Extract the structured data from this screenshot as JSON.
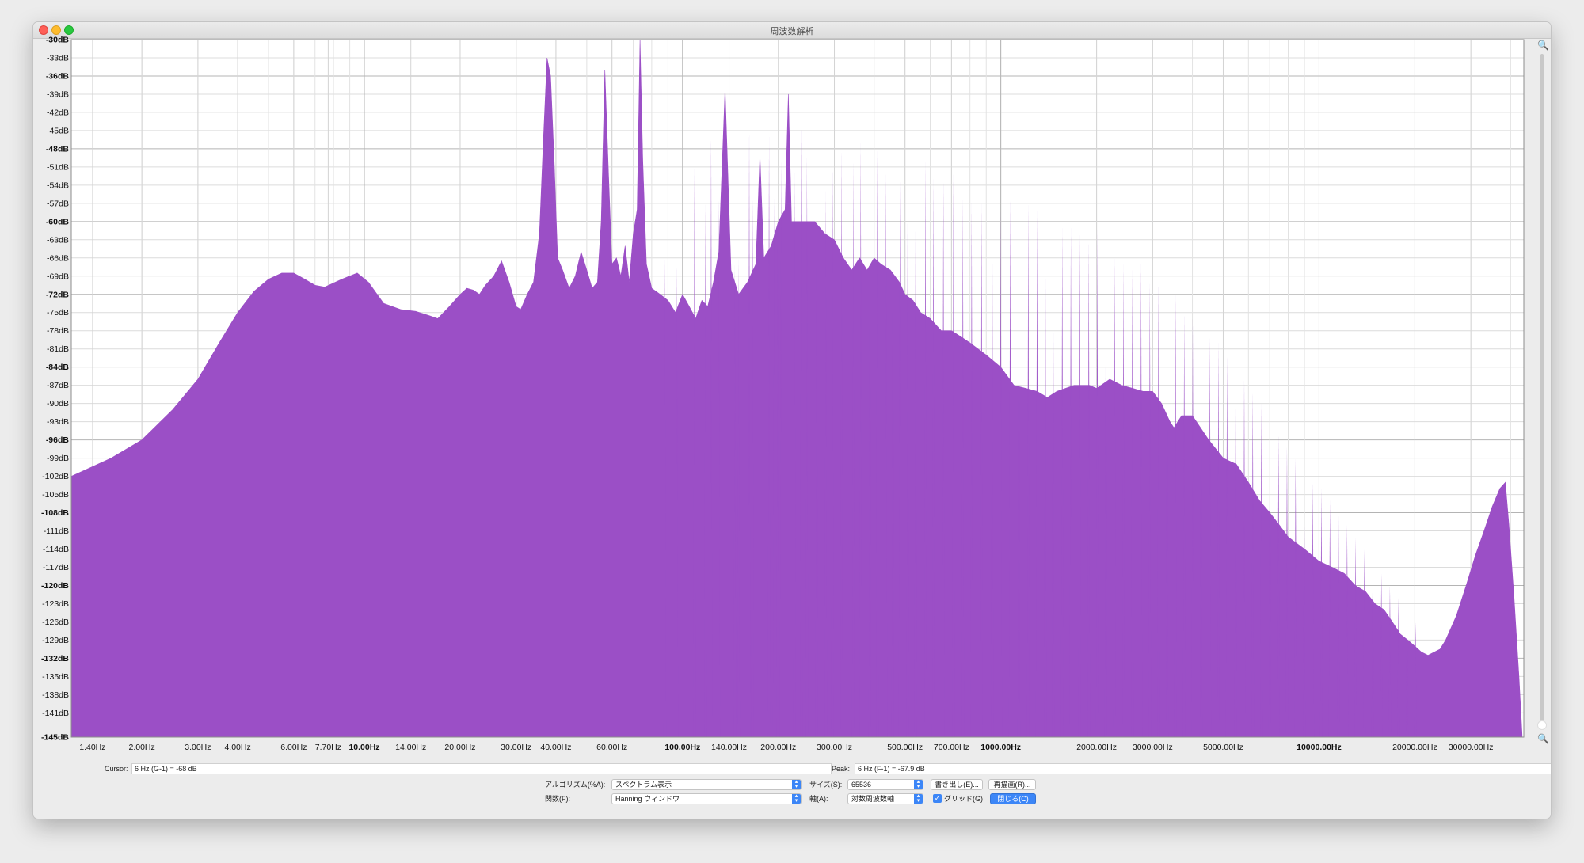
{
  "window": {
    "title": "周波数解析"
  },
  "chart_data": {
    "type": "area",
    "x_scale": "log",
    "ylim": [
      -145,
      -30
    ],
    "xlim": [
      1.2,
      44000
    ],
    "grid": true,
    "fill_color": "#9b4fc6",
    "y_ticks": [
      {
        "v": -30,
        "label": "-30dB",
        "bold": true
      },
      {
        "v": -33,
        "label": "-33dB",
        "bold": false
      },
      {
        "v": -36,
        "label": "-36dB",
        "bold": true
      },
      {
        "v": -39,
        "label": "-39dB",
        "bold": false
      },
      {
        "v": -42,
        "label": "-42dB",
        "bold": false
      },
      {
        "v": -45,
        "label": "-45dB",
        "bold": false
      },
      {
        "v": -48,
        "label": "-48dB",
        "bold": true
      },
      {
        "v": -51,
        "label": "-51dB",
        "bold": false
      },
      {
        "v": -54,
        "label": "-54dB",
        "bold": false
      },
      {
        "v": -57,
        "label": "-57dB",
        "bold": false
      },
      {
        "v": -60,
        "label": "-60dB",
        "bold": true
      },
      {
        "v": -63,
        "label": "-63dB",
        "bold": false
      },
      {
        "v": -66,
        "label": "-66dB",
        "bold": false
      },
      {
        "v": -69,
        "label": "-69dB",
        "bold": false
      },
      {
        "v": -72,
        "label": "-72dB",
        "bold": true
      },
      {
        "v": -75,
        "label": "-75dB",
        "bold": false
      },
      {
        "v": -78,
        "label": "-78dB",
        "bold": false
      },
      {
        "v": -81,
        "label": "-81dB",
        "bold": false
      },
      {
        "v": -84,
        "label": "-84dB",
        "bold": true
      },
      {
        "v": -87,
        "label": "-87dB",
        "bold": false
      },
      {
        "v": -90,
        "label": "-90dB",
        "bold": false
      },
      {
        "v": -93,
        "label": "-93dB",
        "bold": false
      },
      {
        "v": -96,
        "label": "-96dB",
        "bold": true
      },
      {
        "v": -99,
        "label": "-99dB",
        "bold": false
      },
      {
        "v": -102,
        "label": "-102dB",
        "bold": false
      },
      {
        "v": -105,
        "label": "-105dB",
        "bold": false
      },
      {
        "v": -108,
        "label": "-108dB",
        "bold": true
      },
      {
        "v": -111,
        "label": "-111dB",
        "bold": false
      },
      {
        "v": -114,
        "label": "-114dB",
        "bold": false
      },
      {
        "v": -117,
        "label": "-117dB",
        "bold": false
      },
      {
        "v": -120,
        "label": "-120dB",
        "bold": true
      },
      {
        "v": -123,
        "label": "-123dB",
        "bold": false
      },
      {
        "v": -126,
        "label": "-126dB",
        "bold": false
      },
      {
        "v": -129,
        "label": "-129dB",
        "bold": false
      },
      {
        "v": -132,
        "label": "-132dB",
        "bold": true
      },
      {
        "v": -135,
        "label": "-135dB",
        "bold": false
      },
      {
        "v": -138,
        "label": "-138dB",
        "bold": false
      },
      {
        "v": -141,
        "label": "-141dB",
        "bold": false
      },
      {
        "v": -145,
        "label": "-145dB",
        "bold": true
      }
    ],
    "x_ticks": [
      {
        "v": 1.4,
        "label": "1.40Hz",
        "bold": false
      },
      {
        "v": 2,
        "label": "2.00Hz",
        "bold": false
      },
      {
        "v": 3,
        "label": "3.00Hz",
        "bold": false
      },
      {
        "v": 4,
        "label": "4.00Hz",
        "bold": false
      },
      {
        "v": 6,
        "label": "6.00Hz",
        "bold": false
      },
      {
        "v": 7.7,
        "label": "7.70Hz",
        "bold": false
      },
      {
        "v": 10,
        "label": "10.00Hz",
        "bold": true
      },
      {
        "v": 14,
        "label": "14.00Hz",
        "bold": false
      },
      {
        "v": 20,
        "label": "20.00Hz",
        "bold": false
      },
      {
        "v": 30,
        "label": "30.00Hz",
        "bold": false
      },
      {
        "v": 40,
        "label": "40.00Hz",
        "bold": false
      },
      {
        "v": 60,
        "label": "60.00Hz",
        "bold": false
      },
      {
        "v": 100,
        "label": "100.00Hz",
        "bold": true
      },
      {
        "v": 140,
        "label": "140.00Hz",
        "bold": false
      },
      {
        "v": 200,
        "label": "200.00Hz",
        "bold": false
      },
      {
        "v": 300,
        "label": "300.00Hz",
        "bold": false
      },
      {
        "v": 500,
        "label": "500.00Hz",
        "bold": false
      },
      {
        "v": 700,
        "label": "700.00Hz",
        "bold": false
      },
      {
        "v": 1000,
        "label": "1000.00Hz",
        "bold": true
      },
      {
        "v": 2000,
        "label": "2000.00Hz",
        "bold": false
      },
      {
        "v": 3000,
        "label": "3000.00Hz",
        "bold": false
      },
      {
        "v": 5000,
        "label": "5000.00Hz",
        "bold": false
      },
      {
        "v": 10000,
        "label": "10000.00Hz",
        "bold": true
      },
      {
        "v": 20000,
        "label": "20000.00Hz",
        "bold": false
      },
      {
        "v": 30000,
        "label": "30000.00Hz",
        "bold": false
      }
    ],
    "envelope": [
      [
        1.2,
        -102
      ],
      [
        1.6,
        -99
      ],
      [
        2.0,
        -96
      ],
      [
        2.5,
        -91
      ],
      [
        3.0,
        -86
      ],
      [
        3.5,
        -80
      ],
      [
        4.0,
        -75
      ],
      [
        4.5,
        -71.5
      ],
      [
        5.0,
        -69.5
      ],
      [
        5.5,
        -68.5
      ],
      [
        6.0,
        -68.5
      ],
      [
        6.5,
        -69.5
      ],
      [
        7.0,
        -70.5
      ],
      [
        7.5,
        -70.8
      ],
      [
        8.5,
        -69.5
      ],
      [
        9.5,
        -68.5
      ],
      [
        10.3,
        -70
      ],
      [
        11.5,
        -73.5
      ],
      [
        13,
        -74.5
      ],
      [
        14.5,
        -74.8
      ],
      [
        16,
        -75.5
      ],
      [
        17,
        -76
      ],
      [
        18.5,
        -74
      ],
      [
        20,
        -72
      ],
      [
        21,
        -71
      ],
      [
        22,
        -71.3
      ],
      [
        23,
        -72
      ],
      [
        24,
        -70.5
      ],
      [
        25.5,
        -69
      ],
      [
        27,
        -66.5
      ],
      [
        28.5,
        -70
      ],
      [
        30,
        -74
      ],
      [
        31,
        -74.5
      ],
      [
        32.5,
        -72
      ],
      [
        34,
        -70
      ],
      [
        35.5,
        -62
      ],
      [
        36.5,
        -47
      ],
      [
        37.5,
        -33
      ],
      [
        38.5,
        -36
      ],
      [
        39.5,
        -50
      ],
      [
        40.5,
        -66
      ],
      [
        42,
        -68
      ],
      [
        44,
        -71
      ],
      [
        46,
        -69
      ],
      [
        48,
        -65
      ],
      [
        50,
        -68
      ],
      [
        52,
        -71
      ],
      [
        54,
        -70
      ],
      [
        55.5,
        -60
      ],
      [
        57,
        -35
      ],
      [
        58.5,
        -52
      ],
      [
        60,
        -67
      ],
      [
        62,
        -66
      ],
      [
        64,
        -69
      ],
      [
        66,
        -64
      ],
      [
        68,
        -70
      ],
      [
        70,
        -62
      ],
      [
        72,
        -58
      ],
      [
        73.5,
        -30
      ],
      [
        75,
        -50
      ],
      [
        77,
        -67
      ],
      [
        80,
        -71
      ],
      [
        85,
        -72
      ],
      [
        90,
        -73
      ],
      [
        95,
        -75
      ],
      [
        100,
        -72
      ],
      [
        105,
        -74
      ],
      [
        110,
        -76
      ],
      [
        115,
        -73
      ],
      [
        120,
        -74
      ],
      [
        125,
        -70
      ],
      [
        130,
        -65
      ],
      [
        136,
        -38
      ],
      [
        142,
        -68
      ],
      [
        150,
        -72
      ],
      [
        160,
        -70
      ],
      [
        170,
        -67
      ],
      [
        175,
        -49
      ],
      [
        180,
        -66
      ],
      [
        190,
        -64
      ],
      [
        200,
        -60
      ],
      [
        210,
        -58
      ],
      [
        215,
        -39
      ],
      [
        220,
        -60
      ],
      [
        240,
        -60
      ],
      [
        260,
        -60
      ],
      [
        280,
        -62
      ],
      [
        300,
        -63
      ],
      [
        320,
        -66
      ],
      [
        340,
        -68
      ],
      [
        360,
        -66
      ],
      [
        380,
        -68
      ],
      [
        400,
        -66
      ],
      [
        420,
        -67
      ],
      [
        450,
        -68
      ],
      [
        480,
        -70
      ],
      [
        500,
        -72
      ],
      [
        530,
        -73
      ],
      [
        560,
        -75
      ],
      [
        600,
        -76
      ],
      [
        650,
        -78
      ],
      [
        700,
        -78
      ],
      [
        750,
        -79
      ],
      [
        800,
        -80
      ],
      [
        900,
        -82
      ],
      [
        1000,
        -84
      ],
      [
        1100,
        -87
      ],
      [
        1200,
        -87.5
      ],
      [
        1300,
        -88
      ],
      [
        1400,
        -89
      ],
      [
        1500,
        -88
      ],
      [
        1700,
        -87
      ],
      [
        1900,
        -87
      ],
      [
        2000,
        -87.5
      ],
      [
        2200,
        -86
      ],
      [
        2400,
        -87
      ],
      [
        2600,
        -87.5
      ],
      [
        2800,
        -88
      ],
      [
        3000,
        -88
      ],
      [
        3200,
        -90
      ],
      [
        3400,
        -93
      ],
      [
        3500,
        -94
      ],
      [
        3700,
        -92
      ],
      [
        4000,
        -92
      ],
      [
        4500,
        -96
      ],
      [
        5000,
        -99
      ],
      [
        5500,
        -100
      ],
      [
        6000,
        -103
      ],
      [
        6500,
        -106
      ],
      [
        7000,
        -108
      ],
      [
        7500,
        -110
      ],
      [
        8000,
        -112
      ],
      [
        9000,
        -114
      ],
      [
        10000,
        -116
      ],
      [
        11000,
        -117
      ],
      [
        12000,
        -118
      ],
      [
        13000,
        -120
      ],
      [
        14000,
        -121
      ],
      [
        15000,
        -123
      ],
      [
        16000,
        -124
      ],
      [
        17000,
        -126
      ],
      [
        18000,
        -128
      ],
      [
        19000,
        -129
      ],
      [
        20000,
        -130
      ],
      [
        21000,
        -131
      ],
      [
        22000,
        -131.5
      ],
      [
        23000,
        -131
      ],
      [
        24000,
        -130.5
      ],
      [
        25000,
        -129
      ],
      [
        27000,
        -125
      ],
      [
        29000,
        -120
      ],
      [
        31000,
        -115
      ],
      [
        33000,
        -111
      ],
      [
        35000,
        -107
      ],
      [
        37000,
        -104
      ],
      [
        38500,
        -103
      ],
      [
        39500,
        -110
      ],
      [
        41000,
        -122
      ],
      [
        42500,
        -135
      ],
      [
        43500,
        -145
      ]
    ],
    "spikes": [
      [
        88,
        -66
      ],
      [
        96,
        -67
      ],
      [
        109,
        -51
      ],
      [
        118,
        -57
      ],
      [
        123,
        -46
      ],
      [
        130,
        -56
      ],
      [
        146,
        -67
      ],
      [
        150,
        -66
      ],
      [
        162,
        -45
      ],
      [
        166,
        -56
      ],
      [
        187,
        -46
      ],
      [
        194,
        -56
      ],
      [
        199,
        -60
      ],
      [
        204,
        -50
      ],
      [
        225,
        -52
      ],
      [
        236,
        -44
      ],
      [
        246,
        -49
      ],
      [
        264,
        -52
      ],
      [
        282,
        -55
      ],
      [
        296,
        -51
      ],
      [
        316,
        -48
      ],
      [
        344,
        -50
      ],
      [
        363,
        -47
      ],
      [
        388,
        -50
      ],
      [
        409,
        -48
      ],
      [
        436,
        -52
      ],
      [
        458,
        -51
      ],
      [
        482,
        -53
      ],
      [
        510,
        -52
      ],
      [
        540,
        -55
      ],
      [
        580,
        -50
      ],
      [
        614,
        -53
      ],
      [
        660,
        -53
      ],
      [
        710,
        -52
      ],
      [
        760,
        -56
      ],
      [
        810,
        -57
      ],
      [
        870,
        -57
      ],
      [
        940,
        -57
      ],
      [
        1000,
        -58
      ],
      [
        1070,
        -56
      ],
      [
        1140,
        -61
      ],
      [
        1220,
        -57
      ],
      [
        1300,
        -58
      ],
      [
        1380,
        -60
      ],
      [
        1460,
        -60
      ],
      [
        1560,
        -61
      ],
      [
        1660,
        -61
      ],
      [
        1770,
        -62
      ],
      [
        1890,
        -63
      ],
      [
        2010,
        -61
      ],
      [
        2140,
        -63
      ],
      [
        2280,
        -66
      ],
      [
        2430,
        -67
      ],
      [
        2590,
        -68
      ],
      [
        2760,
        -67
      ],
      [
        2940,
        -70
      ],
      [
        3130,
        -70
      ],
      [
        3330,
        -72
      ],
      [
        3540,
        -72
      ],
      [
        3770,
        -75
      ],
      [
        4010,
        -76
      ],
      [
        4260,
        -77
      ],
      [
        4540,
        -79
      ],
      [
        4830,
        -80
      ],
      [
        5140,
        -82
      ],
      [
        5470,
        -84
      ],
      [
        5820,
        -86
      ],
      [
        6190,
        -88
      ],
      [
        6590,
        -90
      ],
      [
        7010,
        -92
      ],
      [
        7460,
        -95
      ],
      [
        7930,
        -97
      ],
      [
        8440,
        -99
      ],
      [
        8980,
        -101
      ],
      [
        9560,
        -103
      ],
      [
        10170,
        -104
      ],
      [
        10820,
        -106
      ],
      [
        11510,
        -108
      ],
      [
        12250,
        -110
      ],
      [
        13030,
        -112
      ],
      [
        13870,
        -114
      ],
      [
        14750,
        -116
      ],
      [
        15700,
        -118
      ],
      [
        16700,
        -120
      ],
      [
        17770,
        -122
      ],
      [
        18900,
        -124
      ],
      [
        20100,
        -126
      ]
    ]
  },
  "status": {
    "cursor_label": "Cursor:",
    "cursor_value": "6 Hz (G-1) = -68 dB",
    "peak_label": "Peak:",
    "peak_value": "6 Hz (F-1) = -67.9 dB"
  },
  "controls": {
    "algorithm_label": "アルゴリズム(%A):",
    "algorithm_value": "スペクトラム表示",
    "size_label": "サイズ(S):",
    "size_value": "65536",
    "export_label": "書き出し(E)...",
    "replot_label": "再描画(R)...",
    "function_label": "関数(F):",
    "function_value": "Hanning ウィンドウ",
    "axis_label": "軸(A):",
    "axis_value": "対数周波数軸",
    "grid_label": "グリッド(G)",
    "close_label": "閉じる(C)"
  },
  "colors": {
    "accent": "#3c86f7",
    "spectrum": "#9b4fc6"
  }
}
